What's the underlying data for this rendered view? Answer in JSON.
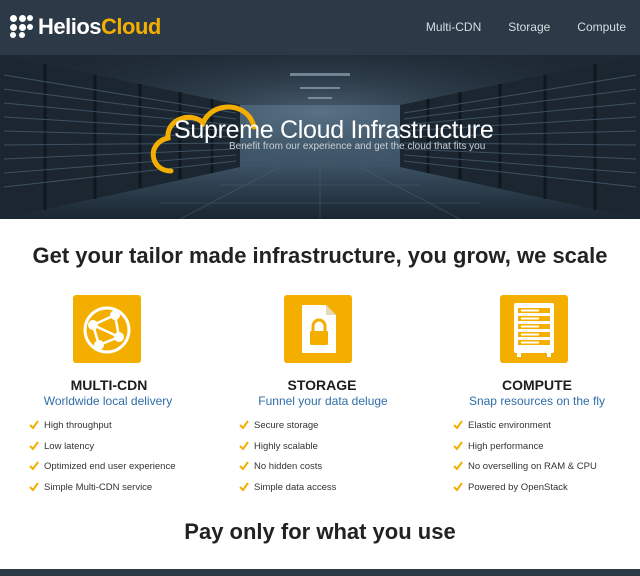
{
  "header": {
    "logo_part1": "Helios",
    "logo_part2": "Cloud",
    "nav": [
      {
        "label": "Multi-CDN"
      },
      {
        "label": "Storage"
      },
      {
        "label": "Compute"
      }
    ]
  },
  "hero": {
    "title": "Supreme Cloud Infrastructure",
    "subtitle": "Benefit from our experience and get the cloud that fits you"
  },
  "tagline": "Get your tailor made infrastructure, you grow, we scale",
  "features": [
    {
      "icon": "network-icon",
      "title": "MULTI-CDN",
      "subtitle": "Worldwide local delivery",
      "items": [
        "High throughput",
        "Low latency",
        "Optimized end user experience",
        "Simple Multi-CDN service"
      ]
    },
    {
      "icon": "locked-file-icon",
      "title": "STORAGE",
      "subtitle": "Funnel your data deluge",
      "items": [
        "Secure storage",
        "Highly scalable",
        "No hidden costs",
        "Simple data access"
      ]
    },
    {
      "icon": "server-rack-icon",
      "title": "COMPUTE",
      "subtitle": "Snap resources on the fly",
      "items": [
        "Elastic environment",
        "High performance",
        "No overselling on RAM & CPU",
        "Powered by OpenStack"
      ]
    }
  ],
  "pay_heading": "Pay only for what you use",
  "colors": {
    "header_bg": "#2b3a46",
    "accent": "#f4ae00",
    "link_blue": "#2f6ea8"
  }
}
